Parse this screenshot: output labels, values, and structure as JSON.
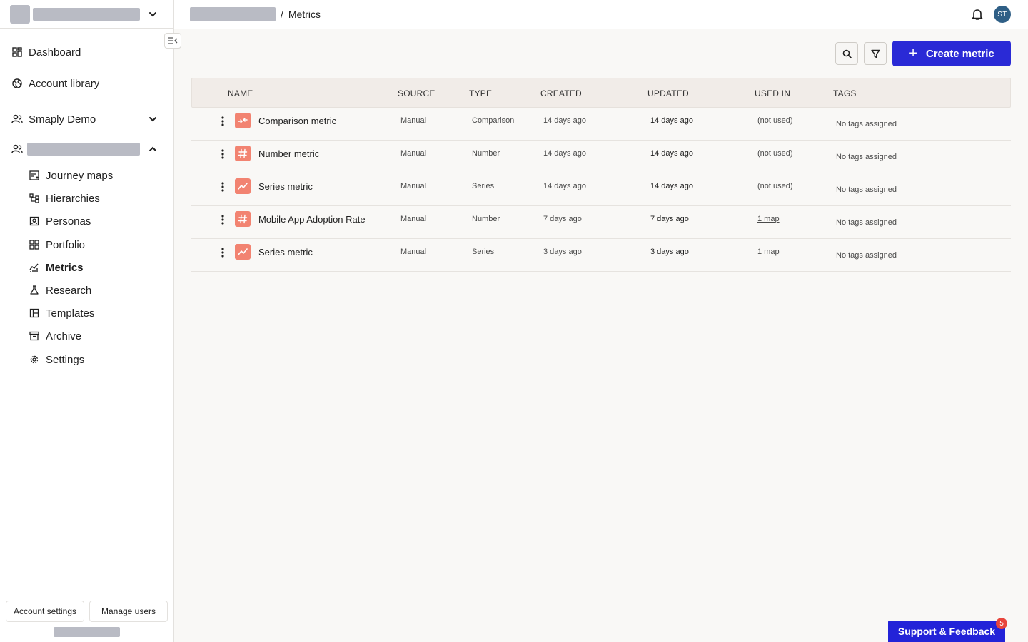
{
  "breadcrumb": {
    "separator": "/",
    "current": "Metrics"
  },
  "header": {
    "avatar_initials": "ST"
  },
  "sidebar": {
    "top_items": [
      {
        "label": "Dashboard",
        "icon": "dashboard-icon"
      },
      {
        "label": "Account library",
        "icon": "globe-icon"
      }
    ],
    "workspace": {
      "label": "Smaply Demo",
      "icon": "users-icon"
    },
    "project_items": [
      {
        "label": "Journey maps",
        "icon": "journey-map-icon"
      },
      {
        "label": "Hierarchies",
        "icon": "hierarchy-icon"
      },
      {
        "label": "Personas",
        "icon": "persona-icon"
      },
      {
        "label": "Portfolio",
        "icon": "portfolio-icon"
      },
      {
        "label": "Metrics",
        "icon": "metrics-icon"
      },
      {
        "label": "Research",
        "icon": "flask-icon"
      },
      {
        "label": "Templates",
        "icon": "template-icon"
      },
      {
        "label": "Archive",
        "icon": "archive-icon"
      },
      {
        "label": "Settings",
        "icon": "gear-icon"
      }
    ],
    "footer": {
      "account_settings": "Account settings",
      "manage_users": "Manage users"
    }
  },
  "toolbar": {
    "create_label": "Create metric",
    "create_plus": "+"
  },
  "table": {
    "columns": [
      "NAME",
      "SOURCE",
      "TYPE",
      "CREATED",
      "UPDATED",
      "USED IN",
      "TAGS"
    ],
    "rows": [
      {
        "name": "Comparison metric",
        "source": "Manual",
        "type": "Comparison",
        "created": "14 days ago",
        "updated": "14 days ago",
        "used_in": "(not used)",
        "tags": "No tags assigned",
        "icon": "comparison-icon"
      },
      {
        "name": "Number metric",
        "source": "Manual",
        "type": "Number",
        "created": "14 days ago",
        "updated": "14 days ago",
        "used_in": "(not used)",
        "tags": "No tags assigned",
        "icon": "hash-icon"
      },
      {
        "name": "Series metric",
        "source": "Manual",
        "type": "Series",
        "created": "14 days ago",
        "updated": "14 days ago",
        "used_in": "(not used)",
        "tags": "No tags assigned",
        "icon": "trend-icon"
      },
      {
        "name": "Mobile App Adoption Rate",
        "source": "Manual",
        "type": "Number",
        "created": "7 days ago",
        "updated": "7 days ago",
        "used_in": "1 map",
        "tags": "No tags assigned",
        "icon": "hash-icon"
      },
      {
        "name": "Series metric",
        "source": "Manual",
        "type": "Series",
        "created": "3 days ago",
        "updated": "3 days ago",
        "used_in": "1 map",
        "tags": "No tags assigned",
        "icon": "trend-icon"
      }
    ]
  },
  "support": {
    "label": "Support & Feedback",
    "badge": "5"
  },
  "colors": {
    "accent": "#2a2ad6",
    "metric_icon_bg": "#f28371",
    "avatar_bg": "#2f5f86",
    "badge": "#e8453c"
  }
}
